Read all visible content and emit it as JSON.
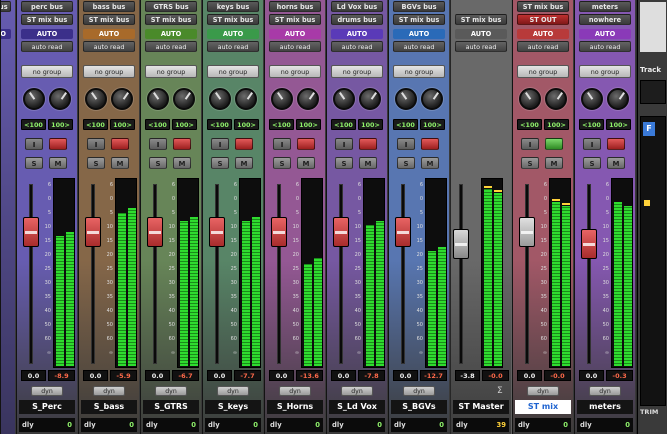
{
  "strips": [
    {
      "name": "S_Perc",
      "output": "perc bus",
      "bus": "ST mix bus",
      "auto": "AUTO",
      "auto_mode": "auto read",
      "group": "no group",
      "pan_l": "<100",
      "pan_r": "100>",
      "vol": "0.0",
      "peak": "-8.9",
      "insert": "dyn",
      "foot_label": "dly",
      "foot_value": "0",
      "color": "#6a5fb8",
      "auto_color": "#3b2f8a",
      "meterL": 0.7,
      "meterR": 0.72,
      "fader": 0.78,
      "rec_green": false,
      "selected": false
    },
    {
      "name": "S_bass",
      "output": "bass bus",
      "bus": "ST mix bus",
      "auto": "AUTO",
      "auto_mode": "auto read",
      "group": "no group",
      "pan_l": "<100",
      "pan_r": "100>",
      "vol": "0.0",
      "peak": "-5.9",
      "insert": "dyn",
      "foot_label": "dly",
      "foot_value": "0",
      "color": "#8a6a4a",
      "auto_color": "#a86a2a",
      "meterL": 0.82,
      "meterR": 0.85,
      "fader": 0.78,
      "rec_green": false,
      "selected": false
    },
    {
      "name": "S_GTRS",
      "output": "GTRS bus",
      "bus": "ST mix bus",
      "auto": "AUTO",
      "auto_mode": "auto read",
      "group": "no group",
      "pan_l": "<100",
      "pan_r": "100>",
      "vol": "0.0",
      "peak": "-6.7",
      "insert": "dyn",
      "foot_label": "dly",
      "foot_value": "0",
      "color": "#6a8a5a",
      "auto_color": "#4a8a2a",
      "meterL": 0.78,
      "meterR": 0.8,
      "fader": 0.78,
      "rec_green": false,
      "selected": false
    },
    {
      "name": "S_keys",
      "output": "keys bus",
      "bus": "ST mix bus",
      "auto": "AUTO",
      "auto_mode": "auto read",
      "group": "no group",
      "pan_l": "<100",
      "pan_r": "100>",
      "vol": "0.0",
      "peak": "-7.7",
      "insert": "dyn",
      "foot_label": "dly",
      "foot_value": "0",
      "color": "#5a8a6a",
      "auto_color": "#3a9a4a",
      "meterL": 0.78,
      "meterR": 0.8,
      "fader": 0.78,
      "rec_green": false,
      "selected": false
    },
    {
      "name": "S_Horns",
      "output": "horns bus",
      "bus": "ST mix bus",
      "auto": "AUTO",
      "auto_mode": "auto read",
      "group": "no group",
      "pan_l": "<100",
      "pan_r": "100>",
      "vol": "0.0",
      "peak": "-13.6",
      "insert": "dyn",
      "foot_label": "dly",
      "foot_value": "0",
      "color": "#9a5a9a",
      "auto_color": "#a83aa8",
      "meterL": 0.55,
      "meterR": 0.58,
      "fader": 0.78,
      "rec_green": false,
      "selected": false
    },
    {
      "name": "S_Ld Vox",
      "output": "Ld Vox bus",
      "bus": "drums bus",
      "auto": "AUTO",
      "auto_mode": "auto read",
      "group": "no group",
      "pan_l": "<100",
      "pan_r": "100>",
      "vol": "0.0",
      "peak": "-7.8",
      "insert": "dyn",
      "foot_label": "dly",
      "foot_value": "0",
      "color": "#7a5aa8",
      "auto_color": "#5a3ab8",
      "meterL": 0.76,
      "meterR": 0.78,
      "fader": 0.78,
      "rec_green": false,
      "selected": false
    },
    {
      "name": "S_BGVs",
      "output": "BGVs bus",
      "bus": "ST mix bus",
      "auto": "AUTO",
      "auto_mode": "auto read",
      "group": "no group",
      "pan_l": "<100",
      "pan_r": "100>",
      "vol": "0.0",
      "peak": "-12.7",
      "insert": "dyn",
      "foot_label": "dly",
      "foot_value": "0",
      "color": "#5a7ab8",
      "auto_color": "#2a6ab8",
      "meterL": 0.62,
      "meterR": 0.64,
      "fader": 0.78,
      "rec_green": false,
      "selected": false
    },
    {
      "name": "ST Master",
      "output": "",
      "bus": "ST mix bus",
      "auto": "AUTO",
      "auto_mode": "auto read",
      "group": "",
      "pan_l": "",
      "pan_r": "",
      "vol": "-3.8",
      "peak": "-0.0",
      "insert": "",
      "foot_label": "dly",
      "foot_value": "39",
      "color": "#6a6a6a",
      "auto_color": "#5a5a5a",
      "meterL": 0.95,
      "meterR": 0.93,
      "fader": 0.7,
      "rec_green": false,
      "selected": false,
      "master": true
    },
    {
      "name": "ST mix",
      "output": "ST mix bus",
      "bus": "ST OUT",
      "auto": "AUTO",
      "auto_mode": "auto read",
      "group": "no group",
      "pan_l": "<100",
      "pan_r": "100>",
      "vol": "0.0",
      "peak": "-0.0",
      "insert": "dyn",
      "foot_label": "dly",
      "foot_value": "0",
      "color": "#a85a6a",
      "auto_color": "#b83a3a",
      "meterL": 0.88,
      "meterR": 0.86,
      "fader": 0.78,
      "rec_green": true,
      "selected": true
    },
    {
      "name": "meters",
      "output": "meters",
      "bus": "nowhere",
      "auto": "AUTO",
      "auto_mode": "auto read",
      "group": "no group",
      "pan_l": "<100",
      "pan_r": "100>",
      "vol": "0.0",
      "peak": "-0.3",
      "insert": "dyn",
      "foot_label": "dly",
      "foot_value": "0",
      "color": "#8a5ab8",
      "auto_color": "#8a3ab8",
      "meterL": 0.88,
      "meterR": 0.86,
      "fader": 0.7,
      "rec_green": false,
      "selected": false
    }
  ],
  "left_strip": {
    "output": "bus",
    "auto": "TO",
    "vol": "",
    "color": "#6a5fb8"
  },
  "panel": {
    "track_label": "Track",
    "trim_label": "TRIM",
    "blue_label": "F"
  },
  "scale_marks": [
    "6",
    "0",
    "5",
    "10",
    "15",
    "20",
    "25",
    "30",
    "35",
    "40",
    "50",
    "60",
    "∞"
  ],
  "button_labels": {
    "input": "I",
    "solo": "S",
    "mute": "M"
  }
}
